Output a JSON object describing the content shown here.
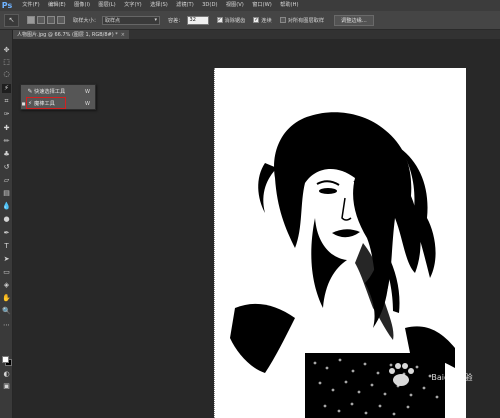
{
  "app": {
    "logo": "Ps"
  },
  "menu": [
    "文件(F)",
    "编辑(E)",
    "图像(I)",
    "图层(L)",
    "文字(Y)",
    "选择(S)",
    "滤镜(T)",
    "3D(D)",
    "视图(V)",
    "窗口(W)",
    "帮助(H)"
  ],
  "options": {
    "tool_glyph": "↖",
    "brush_size_label": "取样大小：",
    "brush_size_value": "取样点",
    "tolerance_label": "容差：",
    "tolerance_value": "32",
    "antialias_label": "消除锯齿",
    "antialias_checked": true,
    "contiguous_label": "连续",
    "contiguous_checked": true,
    "sample_all_label": "对所有图层取样",
    "sample_all_checked": false,
    "refine_edge_label": "调整边缘..."
  },
  "document": {
    "tab_label": "人物图片.jpg @ 66.7% (图层 1, RGB/8#) *",
    "close_glyph": "×"
  },
  "flyout": {
    "items": [
      {
        "label": "快速选择工具",
        "shortcut": "W",
        "icon": "quick-selection-icon",
        "glyph": "✎",
        "selected": false
      },
      {
        "label": "魔棒工具",
        "shortcut": "W",
        "icon": "magic-wand-icon",
        "glyph": "⚡",
        "selected": true
      }
    ]
  },
  "colors": {
    "foreground": "#ffffff",
    "background": "#000000",
    "highlight": "#d42020",
    "menubar": "#3c3c3c",
    "workspace": "#282828"
  },
  "watermark": {
    "text": "Baidu 经验"
  }
}
